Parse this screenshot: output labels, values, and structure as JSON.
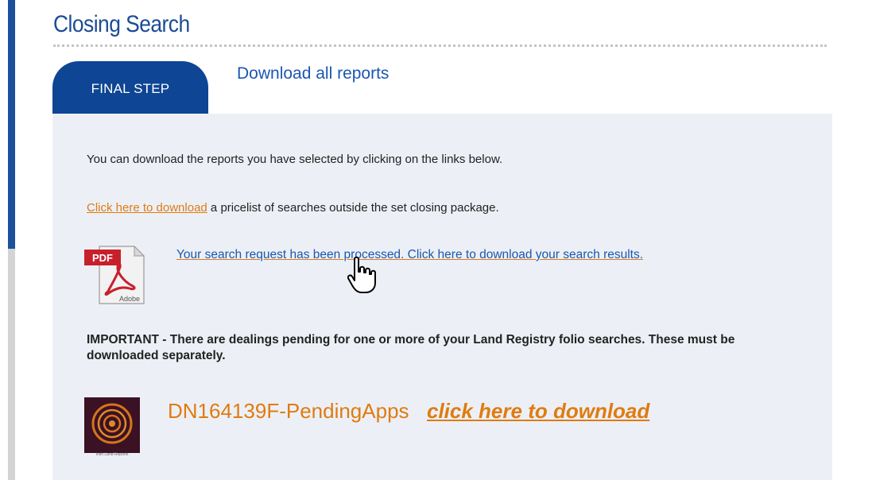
{
  "header": {
    "title": "Closing Search"
  },
  "step": {
    "label": "FINAL STEP",
    "download_all_label": "Download all reports"
  },
  "content": {
    "intro_text": "You can download the reports you have selected by clicking on the links below.",
    "pricelist_link": "Click here to download",
    "pricelist_text": " a pricelist of searches outside the set closing package.",
    "processed_link": "Your search request has been processed. Click here to download your search results.",
    "pdf_icon_label": "PDF",
    "pdf_icon_brand": "Adobe",
    "important_text": "IMPORTANT - There are dealings pending for one or more of your Land Registry folio searches. These must be downloaded separately.",
    "pending_file": "DN164139F-PendingApps",
    "pending_link": "click here to download",
    "pending_icon_caption": "Irish Land Reports"
  },
  "colors": {
    "brand_blue": "#1d4c96",
    "link_blue": "#1b57b0",
    "accent_orange": "#e07b10",
    "panel_bg": "#ecf0f6"
  }
}
